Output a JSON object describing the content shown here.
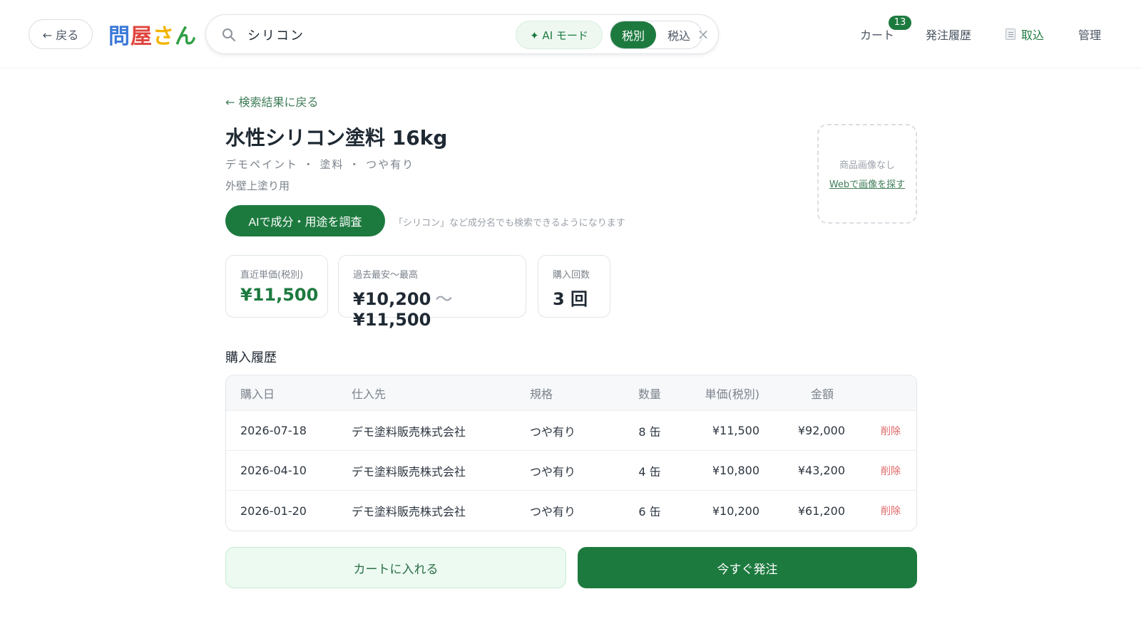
{
  "header": {
    "back_label": "← 戻る",
    "logo": [
      {
        "char": "問",
        "color": "#3b78d8"
      },
      {
        "char": "屋",
        "color": "#e0443e"
      },
      {
        "char": "さ",
        "color": "#f2b400"
      },
      {
        "char": "ん",
        "color": "#2f9e44"
      }
    ],
    "search": {
      "value": "シリコン",
      "clear_icon": "close-icon"
    },
    "ai_mode_label": "✦ AI モード",
    "tax_options": [
      {
        "label": "税別",
        "active": true
      },
      {
        "label": "税込",
        "active": false
      }
    ],
    "nav": {
      "cart_label": "カート",
      "cart_count": "13",
      "history_label": "発注履歴",
      "import_label": "取込",
      "admin_label": "管理"
    }
  },
  "product": {
    "back_link": "← 検索結果に戻る",
    "title": "水性シリコン塗料 16kg",
    "meta": "デモペイント ・ 塗料 ・ つや有り",
    "usage": "外壁上塗り用",
    "ai_button": "AIで成分・用途を調査",
    "ai_hint": "「シリコン」など成分名でも検索できるようになります",
    "image_none": "商品画像なし",
    "image_search_link": "Webで画像を探す"
  },
  "stats": {
    "recent_price_label": "直近単価(税別)",
    "recent_price": "¥11,500",
    "range_label": "過去最安〜最高",
    "range_min": "¥10,200",
    "range_sep": "〜",
    "range_max": "¥11,500",
    "count_label": "購入回数",
    "count_value": "3 回"
  },
  "history": {
    "title": "購入履歴",
    "columns": {
      "date": "購入日",
      "supplier": "仕入先",
      "spec": "規格",
      "qty": "数量",
      "price": "単価(税別)",
      "amount": "金額"
    },
    "rows": [
      {
        "date": "2026-07-18",
        "supplier": "デモ塗料販売株式会社",
        "spec": "つや有り",
        "qty": "8 缶",
        "price": "¥11,500",
        "amount": "¥92,000",
        "delete": "削除"
      },
      {
        "date": "2026-04-10",
        "supplier": "デモ塗料販売株式会社",
        "spec": "つや有り",
        "qty": "4 缶",
        "price": "¥10,800",
        "amount": "¥43,200",
        "delete": "削除"
      },
      {
        "date": "2026-01-20",
        "supplier": "デモ塗料販売株式会社",
        "spec": "つや有り",
        "qty": "6 缶",
        "price": "¥10,200",
        "amount": "¥61,200",
        "delete": "削除"
      }
    ]
  },
  "actions": {
    "add_to_cart": "カートに入れる",
    "order_now": "今すぐ発注"
  },
  "colors": {
    "accent": "#1d7a3f",
    "delete": "#e06666"
  }
}
